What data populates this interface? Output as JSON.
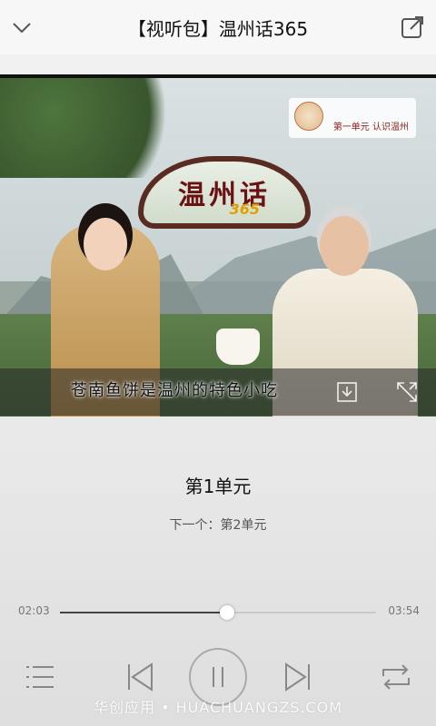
{
  "header": {
    "title": "【视听包】温州话365",
    "back_icon": "chevron-down-icon",
    "share_icon": "share-icon"
  },
  "video": {
    "logo_text": "温州话",
    "logo_number": "365",
    "unit_tag": "第一单元 认识温州",
    "subtitle": "苍南鱼饼是温州的特色小吃",
    "download_icon": "download-icon",
    "fullscreen_icon": "fullscreen-icon"
  },
  "track": {
    "current": "第1单元",
    "next": "下一个：第2单元"
  },
  "progress": {
    "elapsed": "02:03",
    "total": "03:54",
    "fraction": 0.53
  },
  "controls": {
    "playlist_icon": "playlist-icon",
    "prev_icon": "previous-icon",
    "play_icon": "pause-icon",
    "next_icon": "next-icon",
    "repeat_icon": "repeat-icon"
  },
  "watermark": "华创应用 • HUACHUANGZS.COM",
  "colors": {
    "accent": "#444444",
    "track": "#c9c9c9",
    "title_text": "#111111"
  }
}
